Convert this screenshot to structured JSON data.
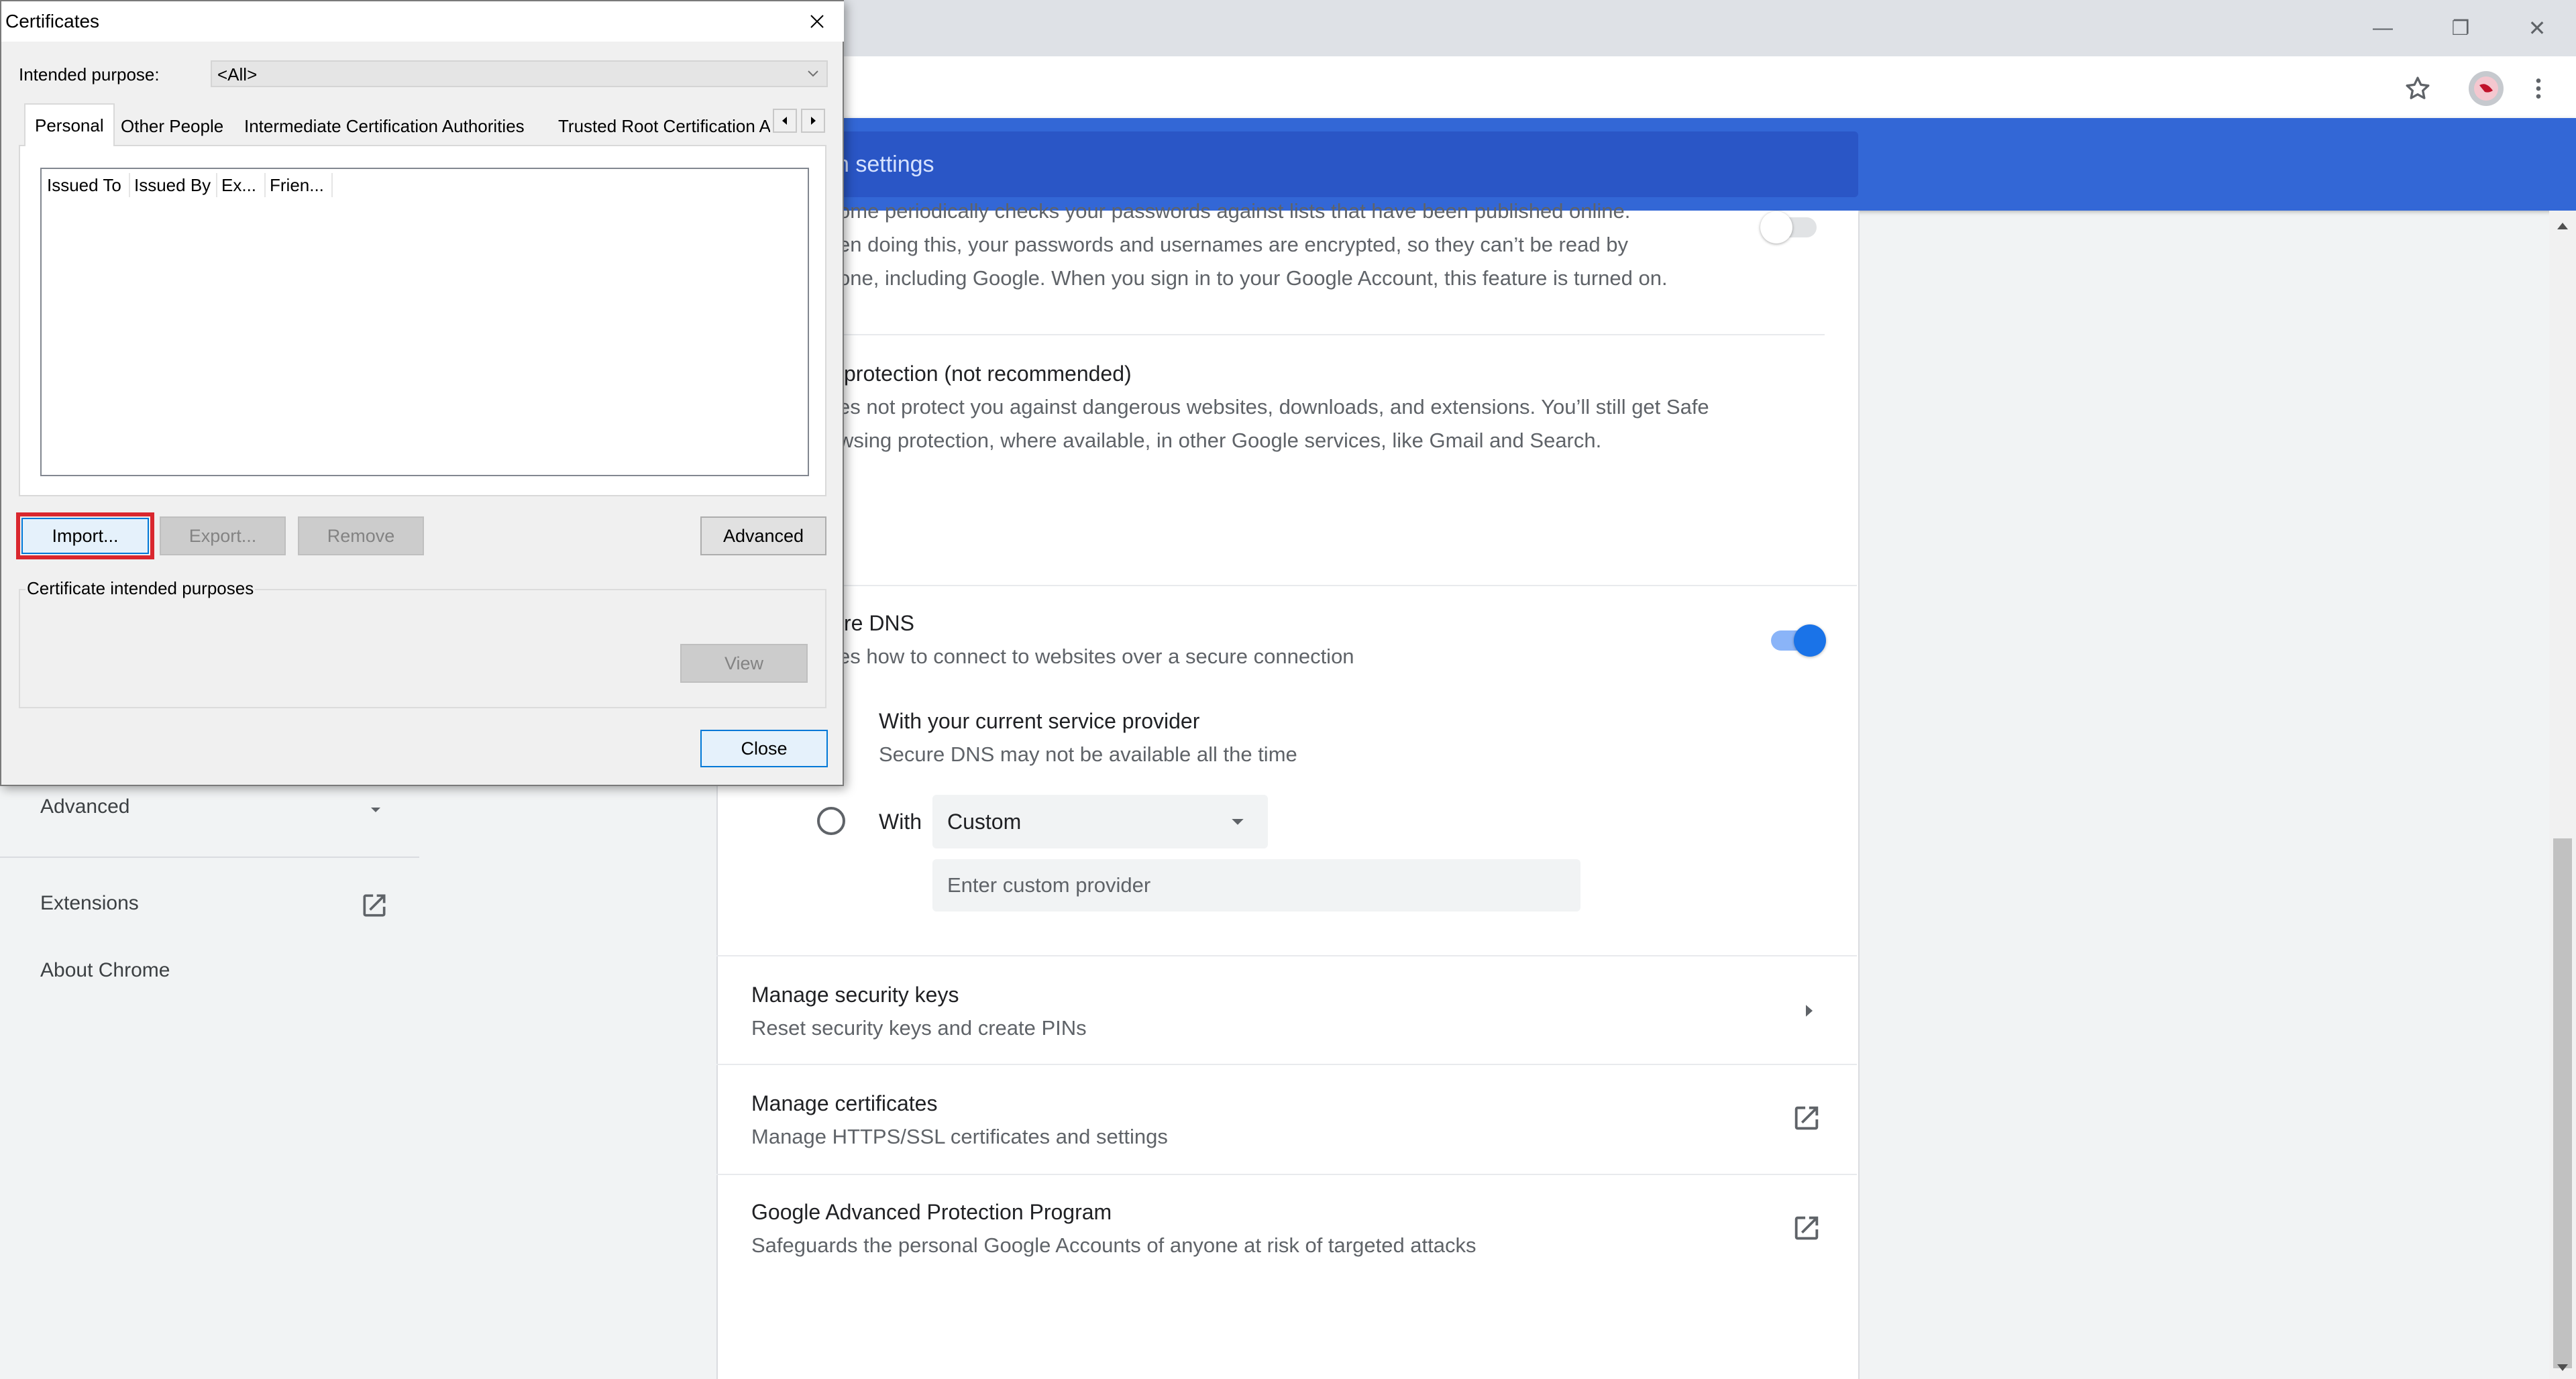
{
  "browser": {
    "window_controls": {
      "minimize": "—",
      "restore": "❐",
      "close": "✕"
    },
    "bookmark_icon": "star-icon",
    "profile_icon": "avatar-icon",
    "menu_icon": "kebab-menu-icon"
  },
  "settings": {
    "search_placeholder": "Search settings",
    "search_placeholder_visible": "ch settings",
    "nav": {
      "advanced": "Advanced",
      "extensions": "Extensions",
      "about": "About Chrome"
    },
    "content": {
      "password_text_1": "ome periodically checks your passwords against lists that have been published online.",
      "password_text_2": "en doing this, your passwords and usernames are encrypted, so they can’t be read by",
      "password_text_3": "one, including Google. When you sign in to your Google Account, this feature is turned on.",
      "no_protection_title": "protection (not recommended)",
      "no_protection_sub_1": "es not protect you against dangerous websites, downloads, and extensions. You’ll still get Safe",
      "no_protection_sub_2": "wsing protection, where available, in other Google services, like Gmail and Search.",
      "secure_dns_title": "re DNS",
      "secure_dns_sub": "es how to connect to websites over a secure connection",
      "current_provider_title": "With your current service provider",
      "current_provider_sub": "Secure DNS may not be available all the time",
      "with_label": "With",
      "custom_select": "Custom",
      "custom_provider_placeholder": "Enter custom provider",
      "security_keys_title": "Manage security keys",
      "security_keys_sub": "Reset security keys and create PINs",
      "certificates_title": "Manage certificates",
      "certificates_sub": "Manage HTTPS/SSL certificates and settings",
      "gapp_title": "Google Advanced Protection Program",
      "gapp_sub": "Safeguards the personal Google Accounts of anyone at risk of targeted attacks"
    },
    "secure_dns_enabled": true,
    "password_check_enabled": false
  },
  "dialog": {
    "title": "Certificates",
    "intended_purpose_label": "Intended purpose:",
    "intended_purpose_value": "<All>",
    "tabs": [
      {
        "label": "Personal"
      },
      {
        "label": "Other People"
      },
      {
        "label": "Intermediate Certification Authorities"
      },
      {
        "label": "Trusted Root Certification A"
      }
    ],
    "columns": [
      "Issued To",
      "Issued By",
      "Ex...",
      "Frien..."
    ],
    "buttons": {
      "import": "Import...",
      "export": "Export...",
      "remove": "Remove",
      "advanced": "Advanced",
      "view": "View",
      "close": "Close"
    },
    "purposes_label": "Certificate intended purposes"
  },
  "colors": {
    "header_blue": "#3367d6",
    "toggle_on": "#1a73e8",
    "highlight_red": "#d9272e"
  }
}
